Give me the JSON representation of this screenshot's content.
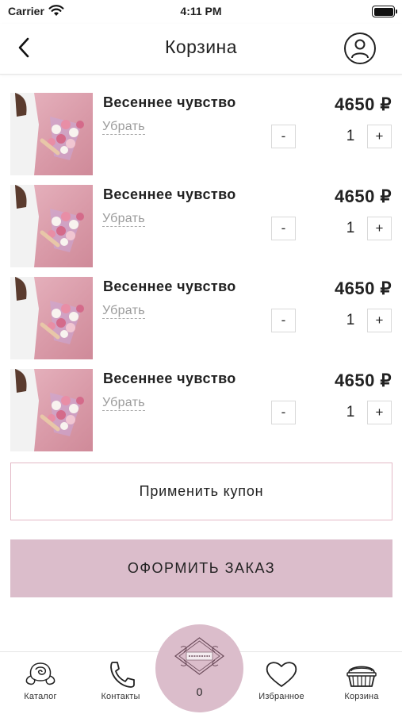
{
  "status_bar": {
    "carrier": "Carrier",
    "time": "4:11 PM"
  },
  "header": {
    "title": "Корзина"
  },
  "cart": {
    "items": [
      {
        "name": "Весеннее чувство",
        "remove_label": "Убрать",
        "price": "4650 ₽",
        "quantity": "1",
        "minus_label": "-",
        "plus_label": "+"
      },
      {
        "name": "Весеннее чувство",
        "remove_label": "Убрать",
        "price": "4650 ₽",
        "quantity": "1",
        "minus_label": "-",
        "plus_label": "+"
      },
      {
        "name": "Весеннее чувство",
        "remove_label": "Убрать",
        "price": "4650 ₽",
        "quantity": "1",
        "minus_label": "-",
        "plus_label": "+"
      },
      {
        "name": "Весеннее чувство",
        "remove_label": "Убрать",
        "price": "4650 ₽",
        "quantity": "1",
        "minus_label": "-",
        "plus_label": "+"
      }
    ]
  },
  "actions": {
    "coupon_label": "Применить купон",
    "checkout_label": "ОФОРМИТЬ ЗАКАЗ"
  },
  "tab_bar": {
    "tabs": [
      {
        "label": "Каталог",
        "icon": "rose-icon"
      },
      {
        "label": "Контакты",
        "icon": "phone-icon"
      },
      {
        "label": "Избранное",
        "icon": "heart-icon"
      },
      {
        "label": "Корзина",
        "icon": "basket-icon"
      }
    ],
    "cart_count": "0"
  },
  "colors": {
    "accent": "#dbbdcb",
    "coupon_border": "#e3b9c6"
  }
}
